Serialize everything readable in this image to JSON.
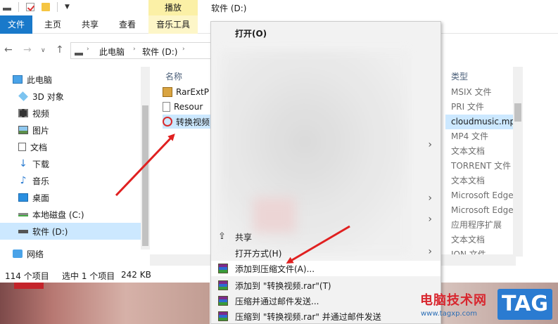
{
  "window": {
    "title": "软件 (D:)",
    "contextual_tab_title": "播放"
  },
  "ribbon": {
    "tabs": [
      "文件",
      "主页",
      "共享",
      "查看",
      "音乐工具"
    ]
  },
  "address": {
    "crumbs": [
      "此电脑",
      "软件 (D:)"
    ]
  },
  "nav_pane": {
    "items": [
      {
        "label": "此电脑",
        "icon": "pc-icon"
      },
      {
        "label": "3D 对象",
        "icon": "cube-icon"
      },
      {
        "label": "视频",
        "icon": "video-icon"
      },
      {
        "label": "图片",
        "icon": "picture-icon"
      },
      {
        "label": "文档",
        "icon": "document-icon"
      },
      {
        "label": "下载",
        "icon": "download-icon"
      },
      {
        "label": "音乐",
        "icon": "music-icon"
      },
      {
        "label": "桌面",
        "icon": "desktop-icon"
      },
      {
        "label": "本地磁盘 (C:)",
        "icon": "drive-icon"
      },
      {
        "label": "软件 (D:)",
        "icon": "drive-icon",
        "selected": true
      },
      {
        "label": "网络",
        "icon": "network-icon"
      }
    ]
  },
  "file_list": {
    "col_name": "名称",
    "col_type": "类型",
    "rows": [
      {
        "name": "RarExtP",
        "icon": "package-icon"
      },
      {
        "name": "Resour",
        "icon": "file-icon"
      },
      {
        "name": "转换视频",
        "icon": "netease-music-icon",
        "selected": true
      }
    ],
    "types": [
      "MSIX 文件",
      "PRI 文件",
      "cloudmusic.mp",
      "MP4 文件",
      "文本文档",
      "TORRENT 文件",
      "文本文档",
      "Microsoft Edge",
      "Microsoft Edge",
      "应用程序扩展",
      "文本文档",
      "ION 文件"
    ]
  },
  "status_bar": {
    "count": "114 个项目",
    "selection": "选中 1 个项目",
    "size": "242 KB"
  },
  "context_menu": {
    "open": "打开(O)",
    "share": "共享",
    "open_with": "打开方式(H)",
    "add_archive": "添加到压缩文件(A)...",
    "add_rar": "添加到 \"转换视频.rar\"(T)",
    "compress_email": "压缩并通过邮件发送...",
    "compress_rar_email": "压缩到 \"转换视频.rar\" 并通过邮件发送"
  },
  "watermark": {
    "site_name": "电脑技术网",
    "url": "www.tagxp.com",
    "tag": "TAG"
  },
  "colors": {
    "accent": "#1979ca",
    "arrow": "#e02020",
    "selection": "#cce8ff"
  }
}
